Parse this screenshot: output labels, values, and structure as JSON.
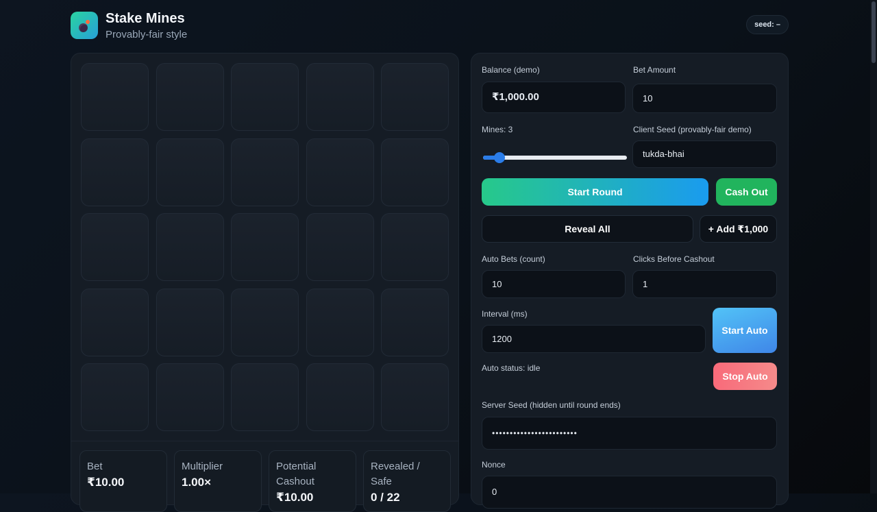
{
  "header": {
    "title": "Stake Mines",
    "subtitle": "Provably-fair style",
    "seed_badge": "seed: –"
  },
  "board": {
    "rows": 5,
    "cols": 5,
    "stats": [
      {
        "label": "Bet",
        "value": "₹10.00"
      },
      {
        "label": "Multiplier",
        "value": "1.00×"
      },
      {
        "label": "Potential Cashout",
        "value": "₹10.00"
      },
      {
        "label": "Revealed / Safe",
        "value": "0 / 22"
      }
    ]
  },
  "controls": {
    "balance_label": "Balance (demo)",
    "balance_value": "₹1,000.00",
    "bet_label": "Bet Amount",
    "bet_value": "10",
    "mines_label": "Mines: 3",
    "mines_value": 3,
    "client_seed_label": "Client Seed (provably-fair demo)",
    "client_seed_value": "tukda-bhai",
    "start_round": "Start Round",
    "cash_out": "Cash Out",
    "reveal_all": "Reveal All",
    "add_funds": "+ Add ₹1,000",
    "auto_bets_label": "Auto Bets (count)",
    "auto_bets_value": "10",
    "clicks_label": "Clicks Before Cashout",
    "clicks_value": "1",
    "interval_label": "Interval (ms)",
    "interval_value": "1200",
    "start_auto": "Start Auto",
    "stop_auto": "Stop Auto",
    "auto_status": "Auto status: idle",
    "server_seed_label": "Server Seed (hidden until round ends)",
    "server_seed_value": "••••••••••••••••••••••••",
    "nonce_label": "Nonce",
    "nonce_value": "0"
  },
  "colors": {
    "accent_green": "#21b45d",
    "accent_blue": "#2b7de9",
    "danger": "#f86a7a"
  }
}
